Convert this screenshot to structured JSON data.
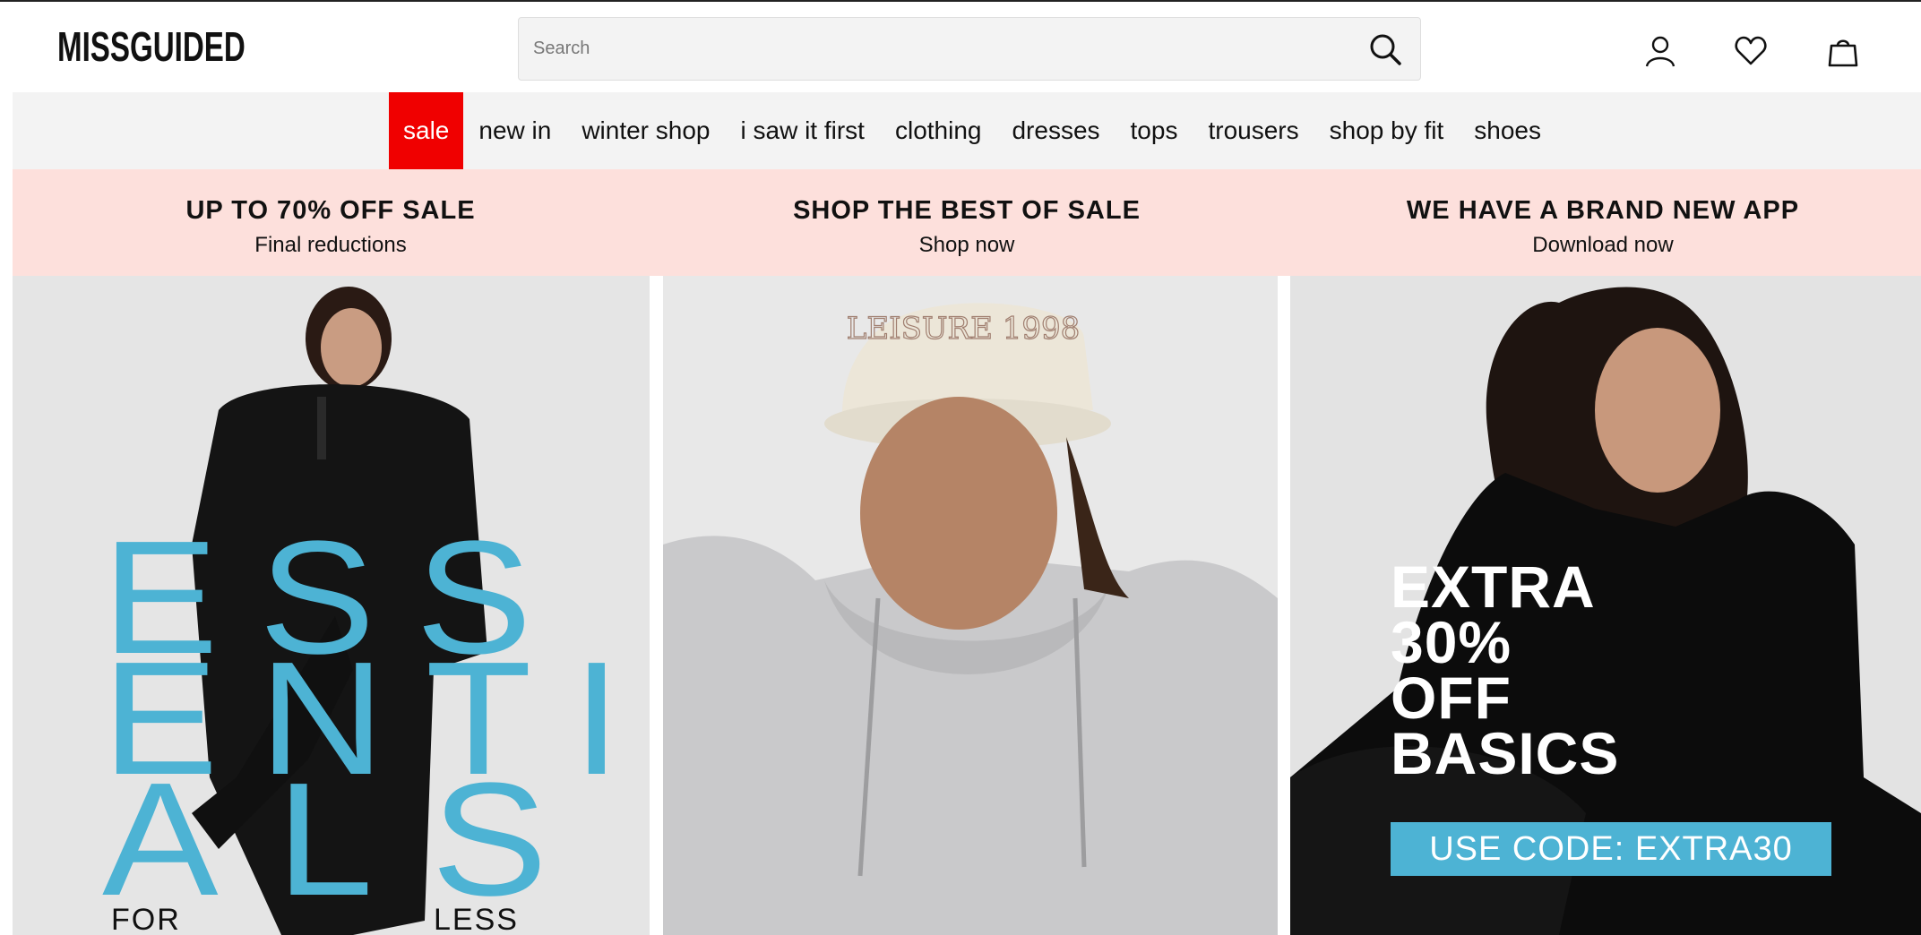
{
  "header": {
    "logo_text": "MISSGUIDED",
    "search": {
      "placeholder": "Search",
      "value": ""
    },
    "icons": [
      "search-icon",
      "account-icon",
      "wishlist-heart-icon",
      "shopping-bag-icon"
    ]
  },
  "nav": {
    "items": [
      {
        "label": "sale",
        "highlight": "#f00000"
      },
      {
        "label": "new in"
      },
      {
        "label": "winter shop"
      },
      {
        "label": "i saw it first"
      },
      {
        "label": "clothing"
      },
      {
        "label": "dresses"
      },
      {
        "label": "tops"
      },
      {
        "label": "trousers"
      },
      {
        "label": "shop by fit"
      },
      {
        "label": "shoes"
      }
    ]
  },
  "promo": [
    {
      "title": "UP TO 70% OFF SALE",
      "subtitle": "Final reductions"
    },
    {
      "title": "SHOP THE BEST OF SALE",
      "subtitle": "Shop now"
    },
    {
      "title": "WE HAVE A BRAND NEW APP",
      "subtitle": "Download now"
    }
  ],
  "tiles": {
    "essentials": {
      "lines": [
        "ESS",
        "ENTI",
        "ALS"
      ],
      "for": "FOR",
      "less": "LESS"
    },
    "cap_text": "LEISURE 1998",
    "extra": {
      "headline": "EXTRA\n30%\nOFF\nBASICS",
      "code": "USE CODE: EXTRA30"
    }
  },
  "colors": {
    "sale_red": "#f00000",
    "promo_pink": "#fde0dc",
    "accent_blue": "#4db3d4",
    "nav_grey": "#f3f3f3"
  }
}
